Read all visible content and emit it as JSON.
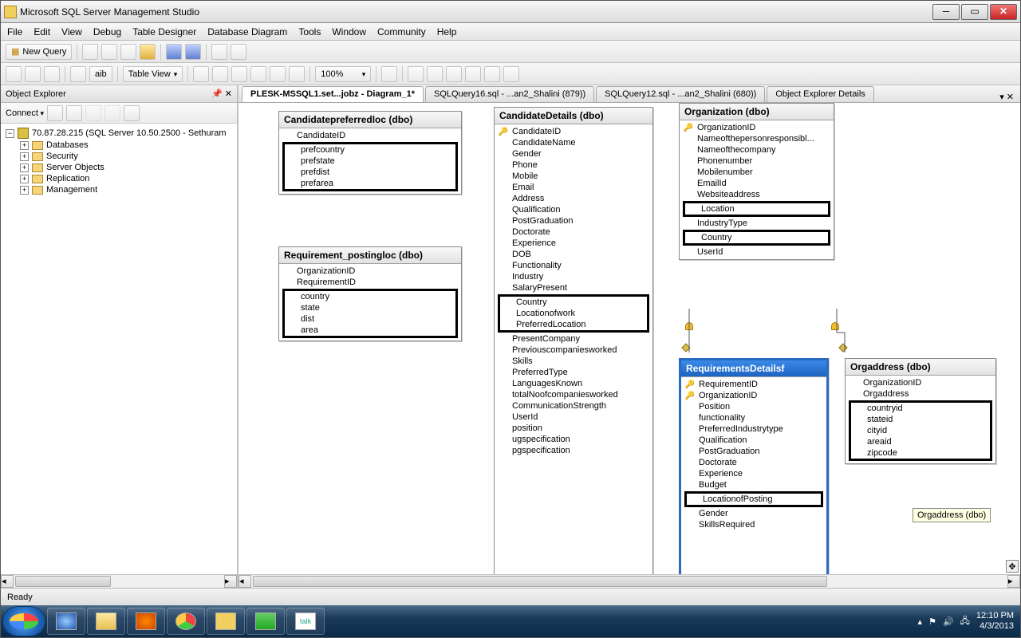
{
  "window": {
    "title": "Microsoft SQL Server Management Studio"
  },
  "menus": [
    "File",
    "Edit",
    "View",
    "Debug",
    "Table Designer",
    "Database Diagram",
    "Tools",
    "Window",
    "Community",
    "Help"
  ],
  "toolbar1": {
    "new_query": "New Query"
  },
  "toolbar2": {
    "table_view": "Table View",
    "zoom": "100%"
  },
  "object_explorer": {
    "title": "Object Explorer",
    "connect": "Connect",
    "root": "70.87.28.215 (SQL Server 10.50.2500 - Sethuram",
    "nodes": [
      "Databases",
      "Security",
      "Server Objects",
      "Replication",
      "Management"
    ]
  },
  "tabs": [
    {
      "label": "PLESK-MSSQL1.set...jobz - Diagram_1*",
      "active": true
    },
    {
      "label": "SQLQuery16.sql - ...an2_Shalini (879))",
      "active": false
    },
    {
      "label": "SQLQuery12.sql - ...an2_Shalini (680))",
      "active": false
    },
    {
      "label": "Object Explorer Details",
      "active": false
    }
  ],
  "tables": {
    "candpref": {
      "title": "Candidatepreferredloc (dbo)",
      "pre": [
        {
          "name": "CandidateID",
          "key": false
        }
      ],
      "hl": [
        "prefcountry",
        "prefstate",
        "prefdist",
        "prefarea"
      ],
      "post": []
    },
    "reqpost": {
      "title": "Requirement_postingloc (dbo)",
      "pre": [
        {
          "name": "OrganizationID",
          "key": false
        },
        {
          "name": "RequirementID",
          "key": false
        }
      ],
      "hl": [
        "country",
        "state",
        "dist",
        "area"
      ],
      "post": []
    },
    "canddet": {
      "title": "CandidateDetails (dbo)",
      "cols": [
        {
          "n": "CandidateID",
          "k": true
        },
        {
          "n": "CandidateName"
        },
        {
          "n": "Gender"
        },
        {
          "n": "Phone"
        },
        {
          "n": "Mobile"
        },
        {
          "n": "Email"
        },
        {
          "n": "Address"
        },
        {
          "n": "Qualification"
        },
        {
          "n": "PostGraduation"
        },
        {
          "n": "Doctorate"
        },
        {
          "n": "Experience"
        },
        {
          "n": "DOB"
        },
        {
          "n": "Functionality"
        },
        {
          "n": "Industry"
        },
        {
          "n": "SalaryPresent"
        }
      ],
      "hl": [
        "Country",
        "Locationofwork",
        "PreferredLocation"
      ],
      "cols2": [
        {
          "n": "PresentCompany"
        },
        {
          "n": "Previouscompaniesworked"
        },
        {
          "n": "Skills"
        },
        {
          "n": "PreferredType"
        },
        {
          "n": "LanguagesKnown"
        },
        {
          "n": "totalNoofcompaniesworked"
        },
        {
          "n": "CommunicationStrength"
        },
        {
          "n": "UserId"
        },
        {
          "n": "position"
        },
        {
          "n": "ugspecification"
        },
        {
          "n": "pgspecification"
        }
      ]
    },
    "org": {
      "title": "Organization (dbo)",
      "cols": [
        {
          "n": "OrganizationID",
          "k": true
        },
        {
          "n": "Nameofthepersonresponsibl..."
        },
        {
          "n": "Nameofthecompany"
        },
        {
          "n": "Phonenumber"
        },
        {
          "n": "Mobilenumber"
        },
        {
          "n": "EmailId"
        },
        {
          "n": "Websiteaddress"
        }
      ],
      "hl1": [
        "Location"
      ],
      "mid": [
        {
          "n": "IndustryType"
        }
      ],
      "hl2": [
        "Country"
      ],
      "post": [
        {
          "n": "UserId"
        }
      ]
    },
    "req": {
      "title": "RequirementsDetailsf",
      "cols": [
        {
          "n": "RequirementID",
          "k": true
        },
        {
          "n": "OrganizationID",
          "k": true
        },
        {
          "n": "Position"
        },
        {
          "n": "functionality"
        },
        {
          "n": "PreferredIndustrytype"
        },
        {
          "n": "Qualification"
        },
        {
          "n": "PostGraduation"
        },
        {
          "n": "Doctorate"
        },
        {
          "n": "Experience"
        },
        {
          "n": "Budget"
        }
      ],
      "hl": [
        "LocationofPosting"
      ],
      "post": [
        {
          "n": "Gender"
        },
        {
          "n": "SkillsRequired"
        }
      ]
    },
    "orgaddr": {
      "title": "Orgaddress (dbo)",
      "pre": [
        {
          "n": "OrganizationID"
        },
        {
          "n": "Orgaddress"
        }
      ],
      "hl": [
        "countryid",
        "stateid",
        "cityid",
        "areaid",
        "zipcode"
      ],
      "post": []
    }
  },
  "tooltip": "Orgaddress (dbo)",
  "status": "Ready",
  "clock": {
    "time": "12:10 PM",
    "date": "4/3/2013"
  }
}
